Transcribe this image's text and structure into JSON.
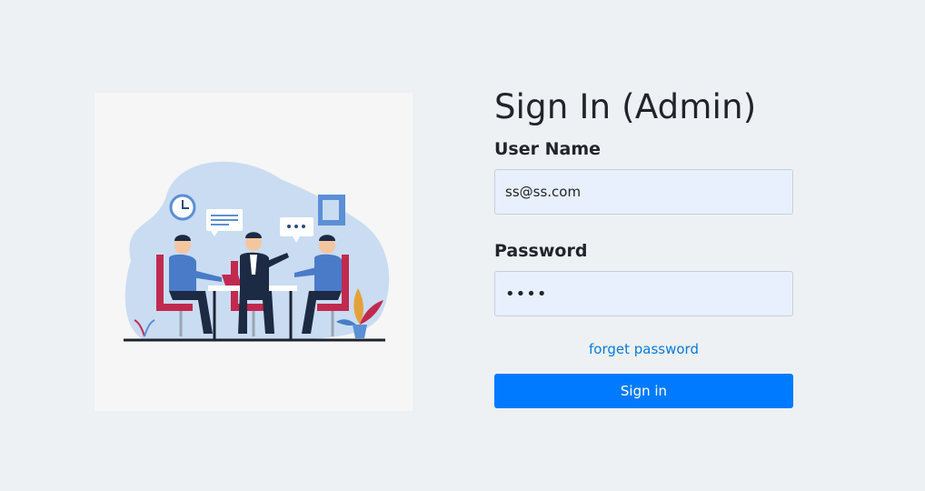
{
  "illustration": {
    "icon": "meeting-illustration"
  },
  "form": {
    "title": "Sign In (Admin)",
    "username_label": "User Name",
    "username_value": "ss@ss.com",
    "password_label": "Password",
    "password_value": "1234",
    "forget_link": "forget password",
    "signin_button": "Sign in"
  },
  "colors": {
    "background": "#edf1f4",
    "accent": "#007bff",
    "input_bg": "#e8f0fe",
    "link": "#0a7bd8"
  }
}
